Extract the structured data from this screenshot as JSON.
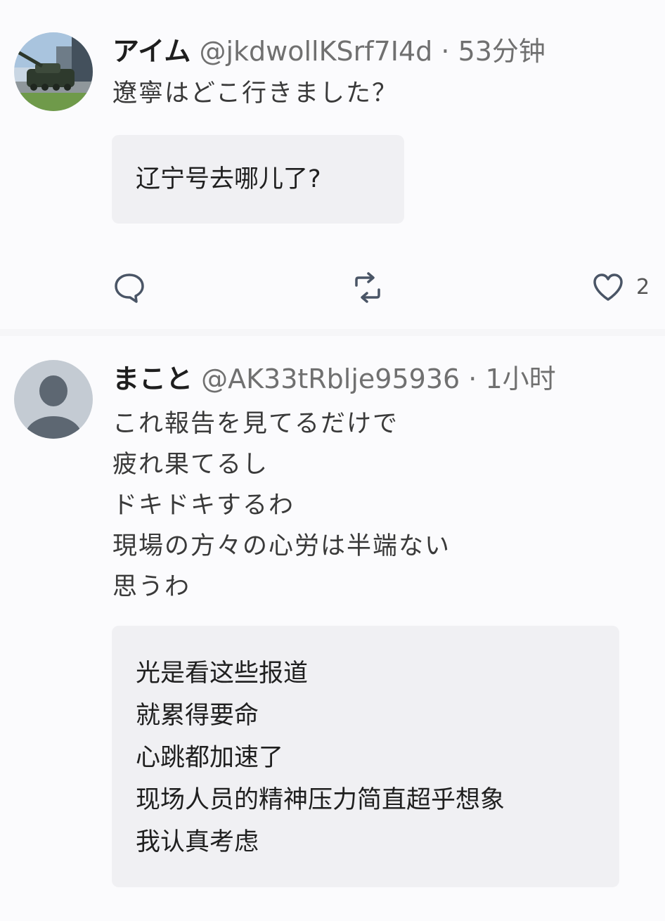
{
  "posts": [
    {
      "author": {
        "name": "アイム",
        "handle": "@jkdwollKSrf7I4d",
        "time": "53分钟"
      },
      "separator": "·",
      "text_lines": [
        "遼寧はどこ行きました？"
      ],
      "translation_lines": [
        "辽宁号去哪儿了?"
      ],
      "actions": {
        "reply_icon": "comment-icon",
        "repost_icon": "repost-icon",
        "like_icon": "heart-icon",
        "like_count": "2"
      }
    },
    {
      "author": {
        "name": "まこと",
        "handle": "@AK33tRblje95936",
        "time": "1小时"
      },
      "separator": "·",
      "text_lines": [
        "これ報告を見てるだけで",
        "疲れ果てるし",
        "ドキドキするわ",
        "現場の方々の心労は半端ない",
        "思うわ"
      ],
      "translation_lines": [
        "光是看这些报道",
        "就累得要命",
        "心跳都加速了",
        "现场人员的精神压力简直超乎想象",
        "我认真考虑"
      ]
    }
  ],
  "colors": {
    "page_background": "#f6f6f8",
    "post_background": "#fbfbfd",
    "translation_background": "#f0f0f3",
    "name_text": "#1e1e1e",
    "meta_text": "#707070",
    "icon_stroke": "#4a5566"
  }
}
